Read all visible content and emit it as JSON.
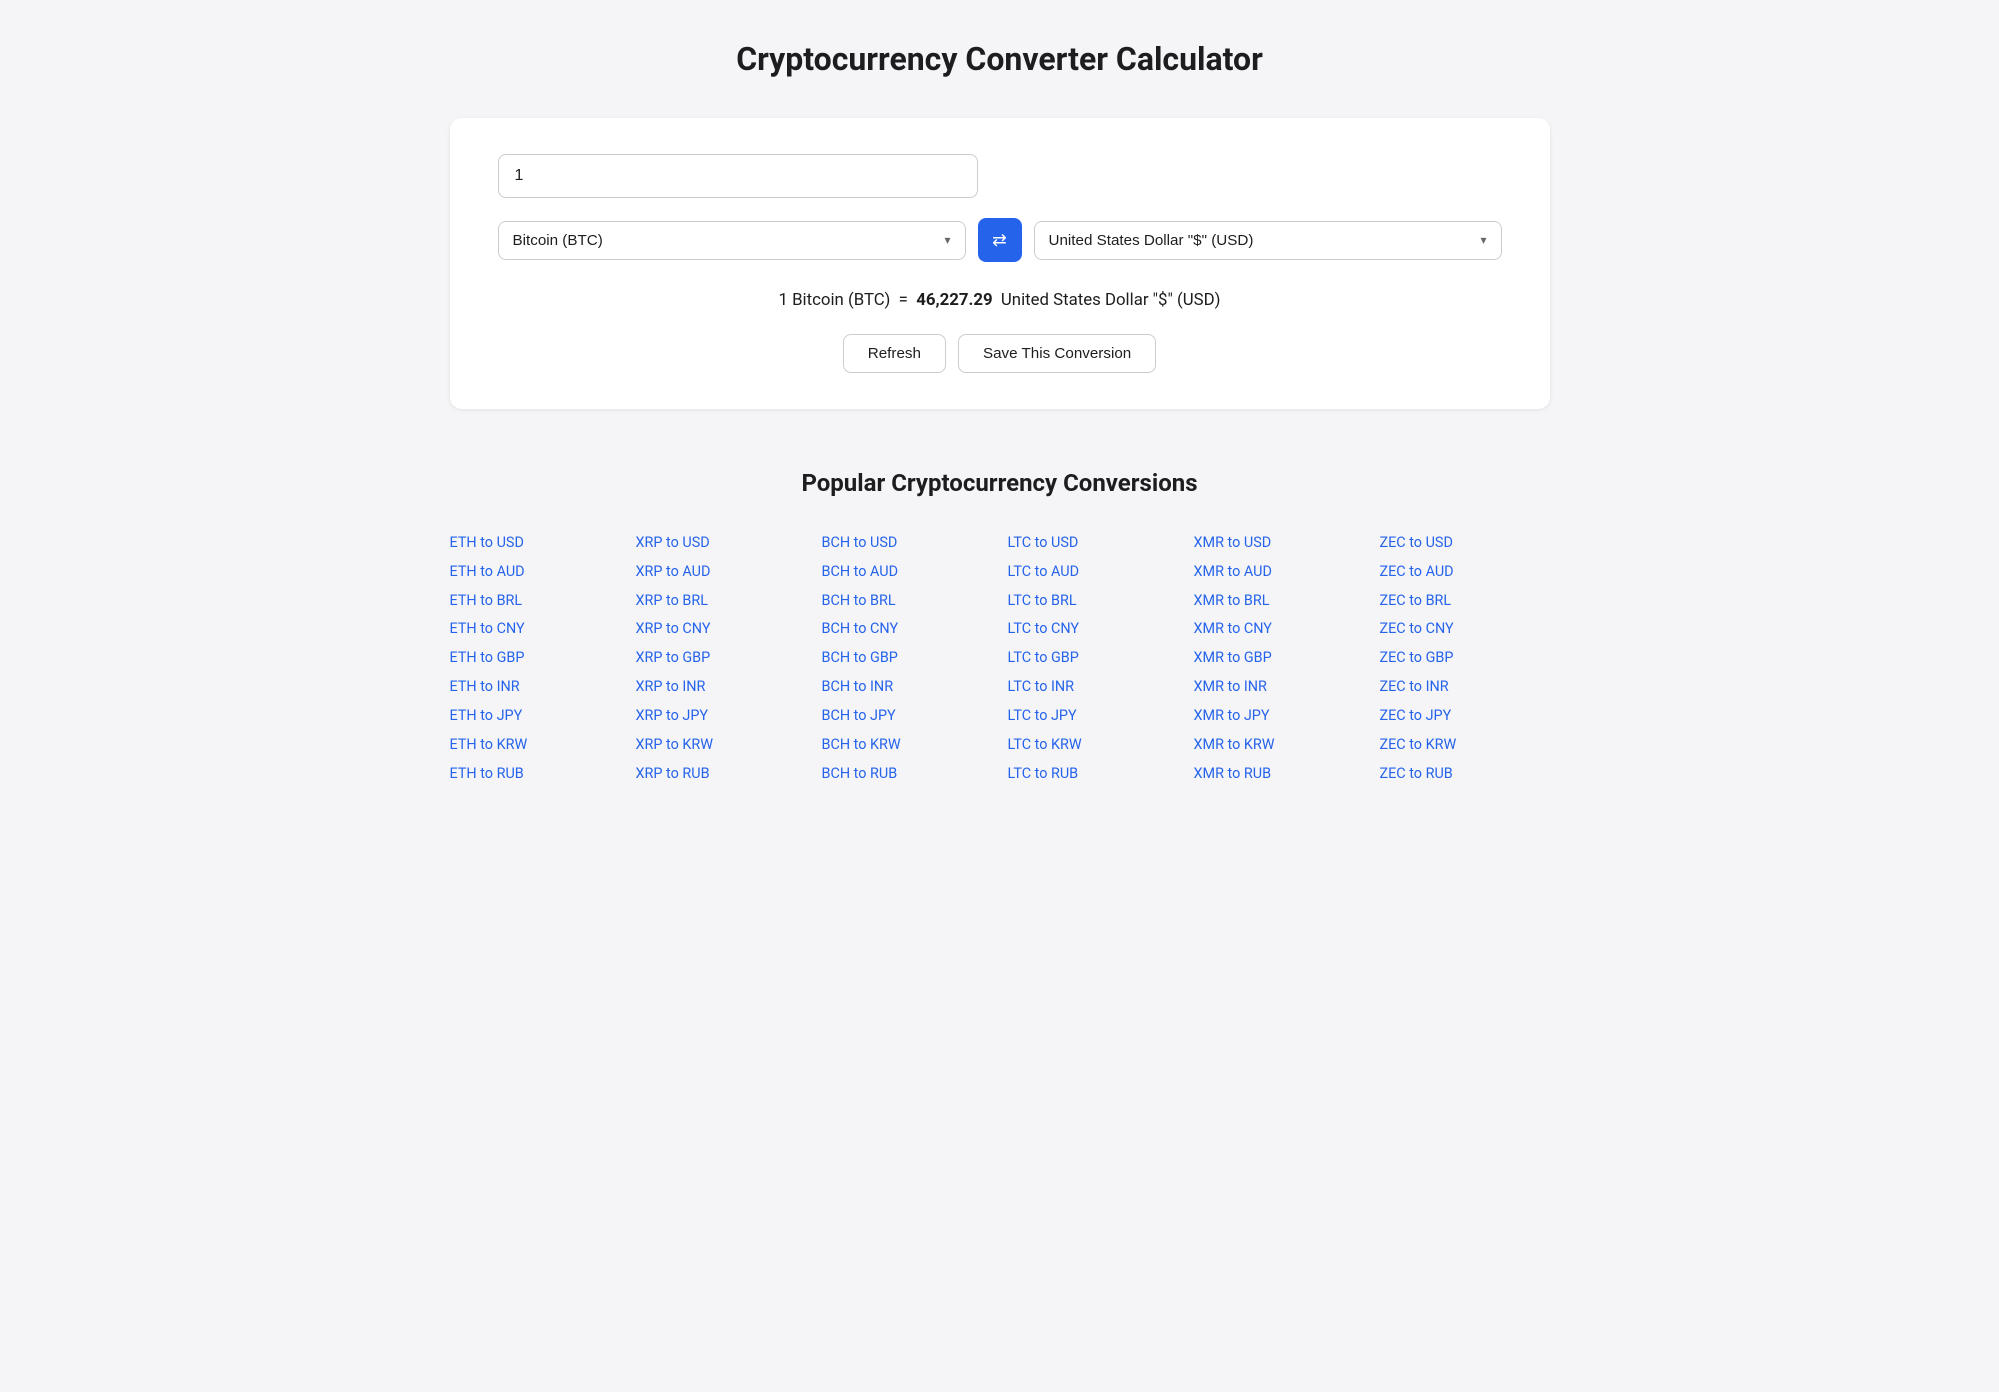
{
  "page": {
    "title": "Cryptocurrency Converter Calculator"
  },
  "converter": {
    "amount_value": "1",
    "from_currency": "Bitcoin (BTC)",
    "to_currency": "United States Dollar \"$\" (USD)",
    "result_text": "1 Bitcoin (BTC)",
    "equals": "=",
    "result_value": "46,227.29",
    "result_currency": "United States Dollar \"$\" (USD)",
    "refresh_label": "Refresh",
    "save_label": "Save This Conversion",
    "swap_icon": "⇄"
  },
  "popular": {
    "title": "Popular Cryptocurrency Conversions",
    "columns": [
      {
        "links": [
          "ETH to USD",
          "ETH to AUD",
          "ETH to BRL",
          "ETH to CNY",
          "ETH to GBP",
          "ETH to INR",
          "ETH to JPY",
          "ETH to KRW",
          "ETH to RUB"
        ]
      },
      {
        "links": [
          "XRP to USD",
          "XRP to AUD",
          "XRP to BRL",
          "XRP to CNY",
          "XRP to GBP",
          "XRP to INR",
          "XRP to JPY",
          "XRP to KRW",
          "XRP to RUB"
        ]
      },
      {
        "links": [
          "BCH to USD",
          "BCH to AUD",
          "BCH to BRL",
          "BCH to CNY",
          "BCH to GBP",
          "BCH to INR",
          "BCH to JPY",
          "BCH to KRW",
          "BCH to RUB"
        ]
      },
      {
        "links": [
          "LTC to USD",
          "LTC to AUD",
          "LTC to BRL",
          "LTC to CNY",
          "LTC to GBP",
          "LTC to INR",
          "LTC to JPY",
          "LTC to KRW",
          "LTC to RUB"
        ]
      },
      {
        "links": [
          "XMR to USD",
          "XMR to AUD",
          "XMR to BRL",
          "XMR to CNY",
          "XMR to GBP",
          "XMR to INR",
          "XMR to JPY",
          "XMR to KRW",
          "XMR to RUB"
        ]
      },
      {
        "links": [
          "ZEC to USD",
          "ZEC to AUD",
          "ZEC to BRL",
          "ZEC to CNY",
          "ZEC to GBP",
          "ZEC to INR",
          "ZEC to JPY",
          "ZEC to KRW",
          "ZEC to RUB"
        ]
      }
    ]
  }
}
